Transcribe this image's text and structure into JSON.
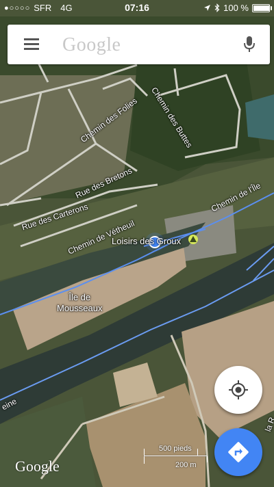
{
  "status_bar": {
    "signal_dots": "●○○○○",
    "carrier": "SFR",
    "network": "4G",
    "time": "07:16",
    "battery": "100 %",
    "battery_level": 1.0
  },
  "search": {
    "placeholder": "Google"
  },
  "map": {
    "roads": [
      "Chemin des Buttes",
      "Chemin des Folies",
      "Rue des Bretons",
      "Rue des Carterons",
      "Chemin de Vétheuil",
      "Chemin de l'Île"
    ],
    "place": "Loisirs des Groux",
    "island": [
      "Île de",
      "Mousseaux"
    ],
    "river": "eine",
    "right_edge_label": "la R"
  },
  "scale": {
    "imperial": "500 pieds",
    "metric": "200 m"
  },
  "attribution": "Google",
  "colors": {
    "accent": "#4285f4",
    "route_line": "#5b8ff0",
    "location_dot": "#4285f4"
  },
  "icons": {
    "menu": "hamburger-icon",
    "mic": "mic-icon",
    "locate": "crosshair-icon",
    "directions": "directions-icon",
    "campsite": "triangle-icon",
    "location": "location-dot-icon"
  }
}
